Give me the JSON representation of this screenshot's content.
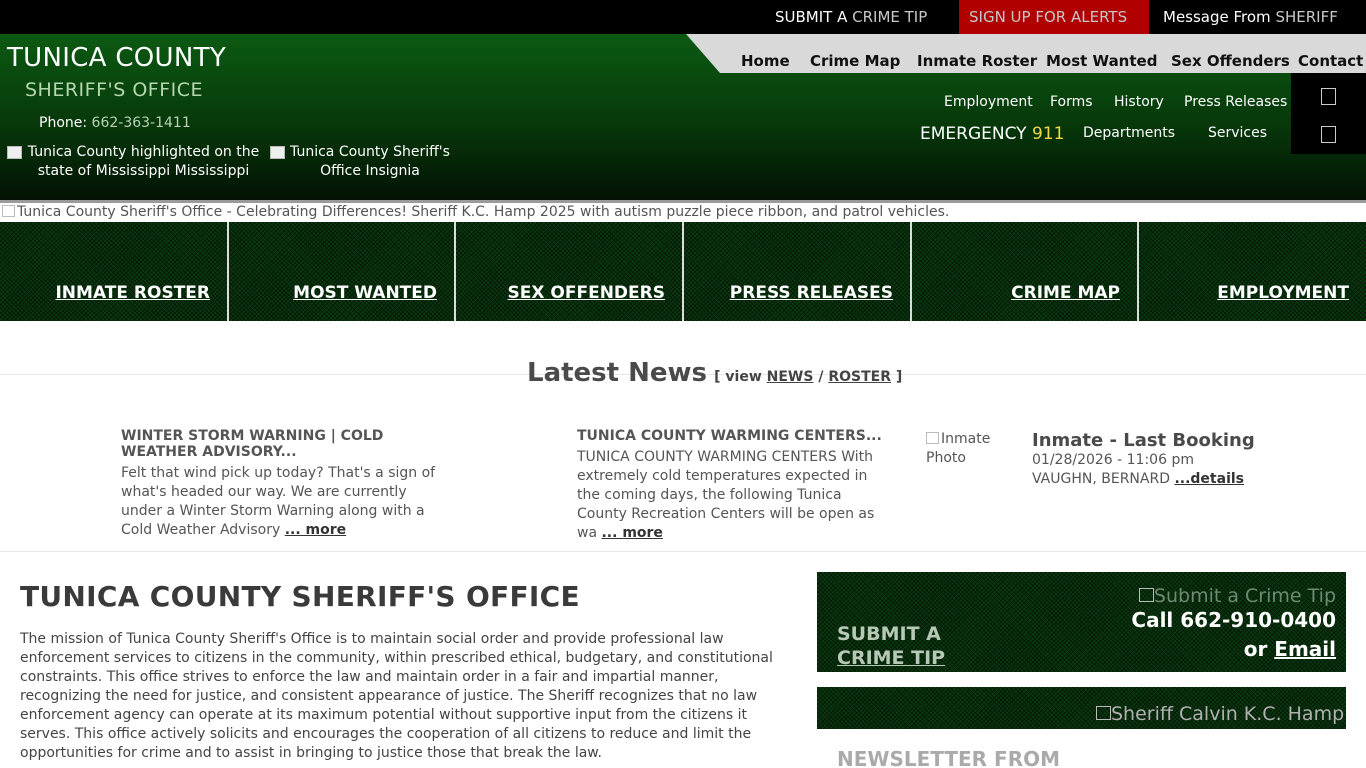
{
  "topbar": {
    "tip_pre": "SUBMIT A",
    "tip_em": "CRIME TIP",
    "tip_icon": "",
    "alerts": "SIGN UP FOR ALERTS",
    "alerts_icon": "",
    "msg_pre": "Message From",
    "msg_em": "SHERIFF",
    "msg_icon": ""
  },
  "header": {
    "title": "TUNICA COUNTY",
    "subtitle": "SHERIFF'S OFFICE",
    "phone_label": "Phone:",
    "phone": "662-363-1411",
    "map_alt": "Tunica County highlighted on the state of Mississippi Mississippi",
    "insignia_alt": "Tunica County Sheriff's Office Insignia"
  },
  "nav_main": [
    "Home",
    "Crime Map",
    "Inmate Roster",
    "Most Wanted",
    "Sex Offenders",
    "Contact"
  ],
  "nav_sub": [
    "Employment",
    "Forms",
    "History",
    "Press Releases"
  ],
  "emergency": {
    "label": "EMERGENCY",
    "number": "911"
  },
  "dropdowns": [
    {
      "label": "Departments",
      "icon": ""
    },
    {
      "label": "Services",
      "icon": ""
    }
  ],
  "banner_alt": "Tunica County Sheriff's Office - Celebrating Differences! Sheriff K.C. Hamp 2025 with autism puzzle piece ribbon, and patrol vehicles.",
  "quick_links": [
    {
      "label": "INMATE ROSTER",
      "icon": ""
    },
    {
      "label": "MOST WANTED",
      "icon": ""
    },
    {
      "label": "SEX OFFENDERS",
      "icon": ""
    },
    {
      "label": "PRESS RELEASES",
      "icon": ""
    },
    {
      "label": "CRIME MAP",
      "icon": ""
    },
    {
      "label": "EMPLOYMENT",
      "icon": ""
    }
  ],
  "news": {
    "heading": "Latest News",
    "view_pre": "[ view",
    "view_news": "NEWS",
    "view_sep": "/",
    "view_roster": "ROSTER",
    "view_post": "]",
    "items": [
      {
        "title": "WINTER STORM WARNING | COLD WEATHER ADVISORY...",
        "body": "Felt that wind pick up today? That's a sign of what's headed our way. We are currently under a Winter Storm Warning along with a Cold Weather Advisory",
        "more": "... more"
      },
      {
        "title": "TUNICA COUNTY WARMING CENTERS...",
        "body": "TUNICA COUNTY WARMING CENTERS With extremely cold temperatures expected in the coming days, the following Tunica County Recreation Centers will be open as wa",
        "more": "... more"
      }
    ],
    "inmate_img_alt": "Inmate Photo",
    "inmate": {
      "title": "Inmate - Last Booking",
      "date": "01/28/2026 - 11:06 pm",
      "name": "VAUGHN, BERNARD",
      "details": "...details"
    }
  },
  "main": {
    "title": "TUNICA COUNTY SHERIFF'S OFFICE",
    "mission": "The mission of Tunica County Sheriff's Office is to maintain social order and provide professional law enforcement services to citizens in the community, within prescribed ethical, budgetary, and constitutional constraints. This office strives to enforce the law and maintain order in a fair and impartial manner, recognizing the need for justice, and consistent appearance of justice. The Sheriff recognizes that no law enforcement agency can operate at its maximum potential without supportive input from the citizens it serves. This office actively solicits and encourages the cooperation of all citizens to reduce and limit the opportunities for crime and to assist in bringing to justice those that break the law."
  },
  "tip_box": {
    "img_alt": "Submit a Crime Tip",
    "label1": "SUBMIT A",
    "label2": "CRIME TIP",
    "icon": "",
    "call": "Call 662-910-0400",
    "or": "or",
    "email": "Email"
  },
  "sheriff_box": {
    "img_alt": "Sheriff Calvin K.C. Hamp"
  },
  "newsletter": "NEWSLETTER FROM"
}
